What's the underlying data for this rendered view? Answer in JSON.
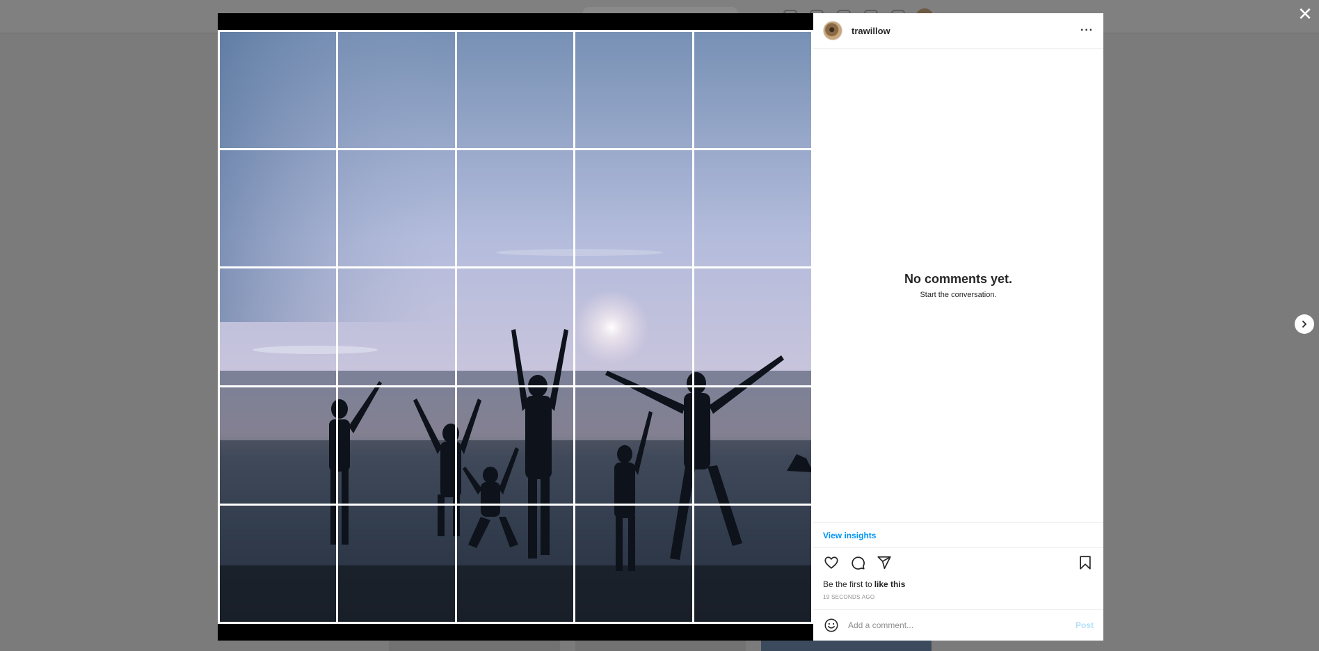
{
  "post": {
    "username": "trawillow",
    "more_label": "···"
  },
  "comments": {
    "empty_title": "No comments yet.",
    "empty_subtitle": "Start the conversation."
  },
  "insights": {
    "label": "View insights"
  },
  "likes": {
    "prefix": "Be the first to",
    "link": "like this"
  },
  "timestamp": "19 SECONDS AGO",
  "comment_box": {
    "placeholder": "Add a comment...",
    "post_label": "Post"
  },
  "controls": {
    "close_label": "✕"
  },
  "colors": {
    "accent": "#0095f6",
    "post_disabled": "#b2dffc",
    "backdrop": "#7b7b7b"
  },
  "icons": [
    "close-icon",
    "chevron-right-icon",
    "more-icon",
    "heart-icon",
    "comment-icon",
    "share-icon",
    "bookmark-icon",
    "emoji-icon"
  ]
}
